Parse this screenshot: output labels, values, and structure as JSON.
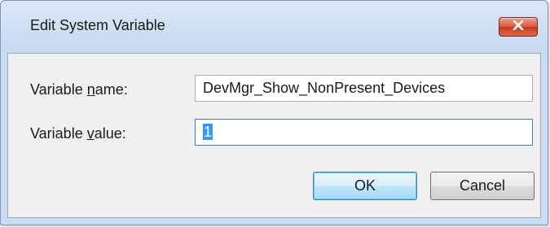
{
  "window": {
    "title": "Edit System Variable"
  },
  "form": {
    "name_label_prefix": "Variable ",
    "name_label_mnemonic": "n",
    "name_label_suffix": "ame:",
    "name_value": "DevMgr_Show_NonPresent_Devices",
    "value_label_prefix": "Variable ",
    "value_label_mnemonic": "v",
    "value_label_suffix": "alue:",
    "value_value": "1"
  },
  "buttons": {
    "ok_label": "OK",
    "cancel_label": "Cancel"
  },
  "colors": {
    "selection": "#3399ff",
    "close_button": "#d9593e",
    "title_bar": "#c5d9f1"
  },
  "icons": {
    "close": "close-icon"
  }
}
